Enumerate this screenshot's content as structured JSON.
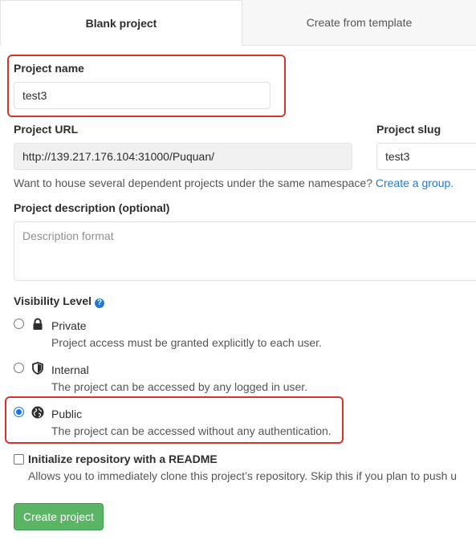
{
  "tabs": {
    "blank": "Blank project",
    "template": "Create from template"
  },
  "project_name": {
    "label": "Project name",
    "value": "test3"
  },
  "project_url": {
    "label": "Project URL",
    "value": "http://139.217.176.104:31000/Puquan/"
  },
  "project_slug": {
    "label": "Project slug",
    "value": "test3"
  },
  "namespace_help": {
    "text": "Want to house several dependent projects under the same namespace?",
    "link": "Create a group."
  },
  "description": {
    "label": "Project description (optional)",
    "placeholder": "Description format"
  },
  "visibility": {
    "label": "Visibility Level",
    "help_icon": "question-circle-icon",
    "options": [
      {
        "title": "Private",
        "desc": "Project access must be granted explicitly to each user.",
        "icon": "lock-icon",
        "checked": false
      },
      {
        "title": "Internal",
        "desc": "The project can be accessed by any logged in user.",
        "icon": "shield-icon",
        "checked": false
      },
      {
        "title": "Public",
        "desc": "The project can be accessed without any authentication.",
        "icon": "globe-icon",
        "checked": true
      }
    ]
  },
  "readme": {
    "label": "Initialize repository with a README",
    "desc": "Allows you to immediately clone this project’s repository. Skip this if you plan to push u",
    "checked": false
  },
  "create_button": "Create project",
  "colors": {
    "highlight_border": "#d9332b",
    "link": "#1f78d1",
    "primary_button": "#5ab565"
  }
}
